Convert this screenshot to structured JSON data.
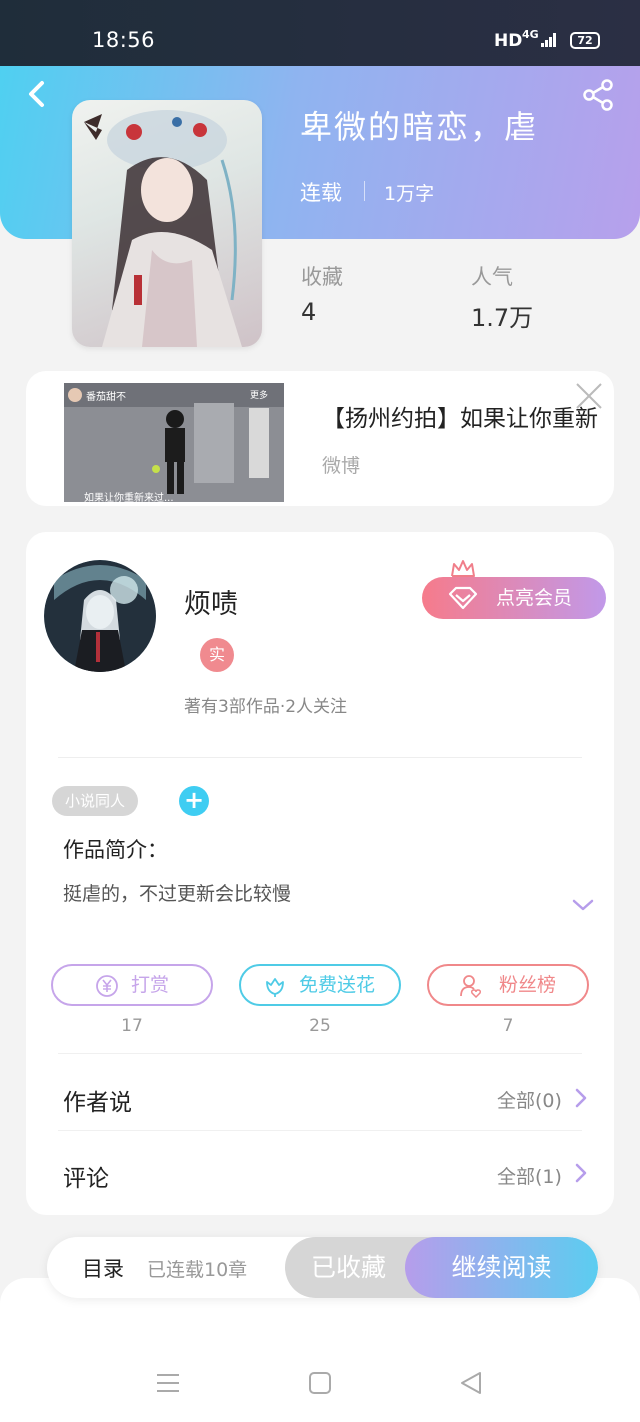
{
  "status_bar": {
    "time": "18:56",
    "network": "HD",
    "signal": "4G",
    "battery": "72"
  },
  "book": {
    "title": "卑微的暗恋，虐",
    "status": "连载",
    "word_count": "1万字",
    "stats": [
      {
        "label": "收藏",
        "value": "4"
      },
      {
        "label": "人气",
        "value": "1.7万"
      }
    ]
  },
  "ad": {
    "title": "【扬州约拍】如果让你重新",
    "source": "微博",
    "image_caption_top": "番茄甜不",
    "image_caption_more": "更多",
    "image_caption_bottom": "如果让你重新来过..."
  },
  "author": {
    "name": "烦啧",
    "real_badge": "实",
    "meta": "著有3部作品·2人关注",
    "vip_button": "点亮会员"
  },
  "tag": "小说同人",
  "intro": {
    "title": "作品简介：",
    "text": "挺虐的，不过更新会比较慢"
  },
  "actions": [
    {
      "label": "打赏",
      "count": "17",
      "color": "#c6a5ea"
    },
    {
      "label": "免费送花",
      "count": "25",
      "color": "#4fcbe6"
    },
    {
      "label": "粉丝榜",
      "count": "7",
      "color": "#f0888a"
    }
  ],
  "sections": [
    {
      "title": "作者说",
      "link": "全部(0)"
    },
    {
      "title": "评论",
      "link": "全部(1)"
    }
  ],
  "bottom_bar": {
    "toc": "目录",
    "chapters": "已连载10章",
    "favorited": "已收藏",
    "continue": "继续阅读"
  },
  "colors": {
    "accent_purple": "#b69deb",
    "accent_cyan": "#4fd0f1"
  }
}
